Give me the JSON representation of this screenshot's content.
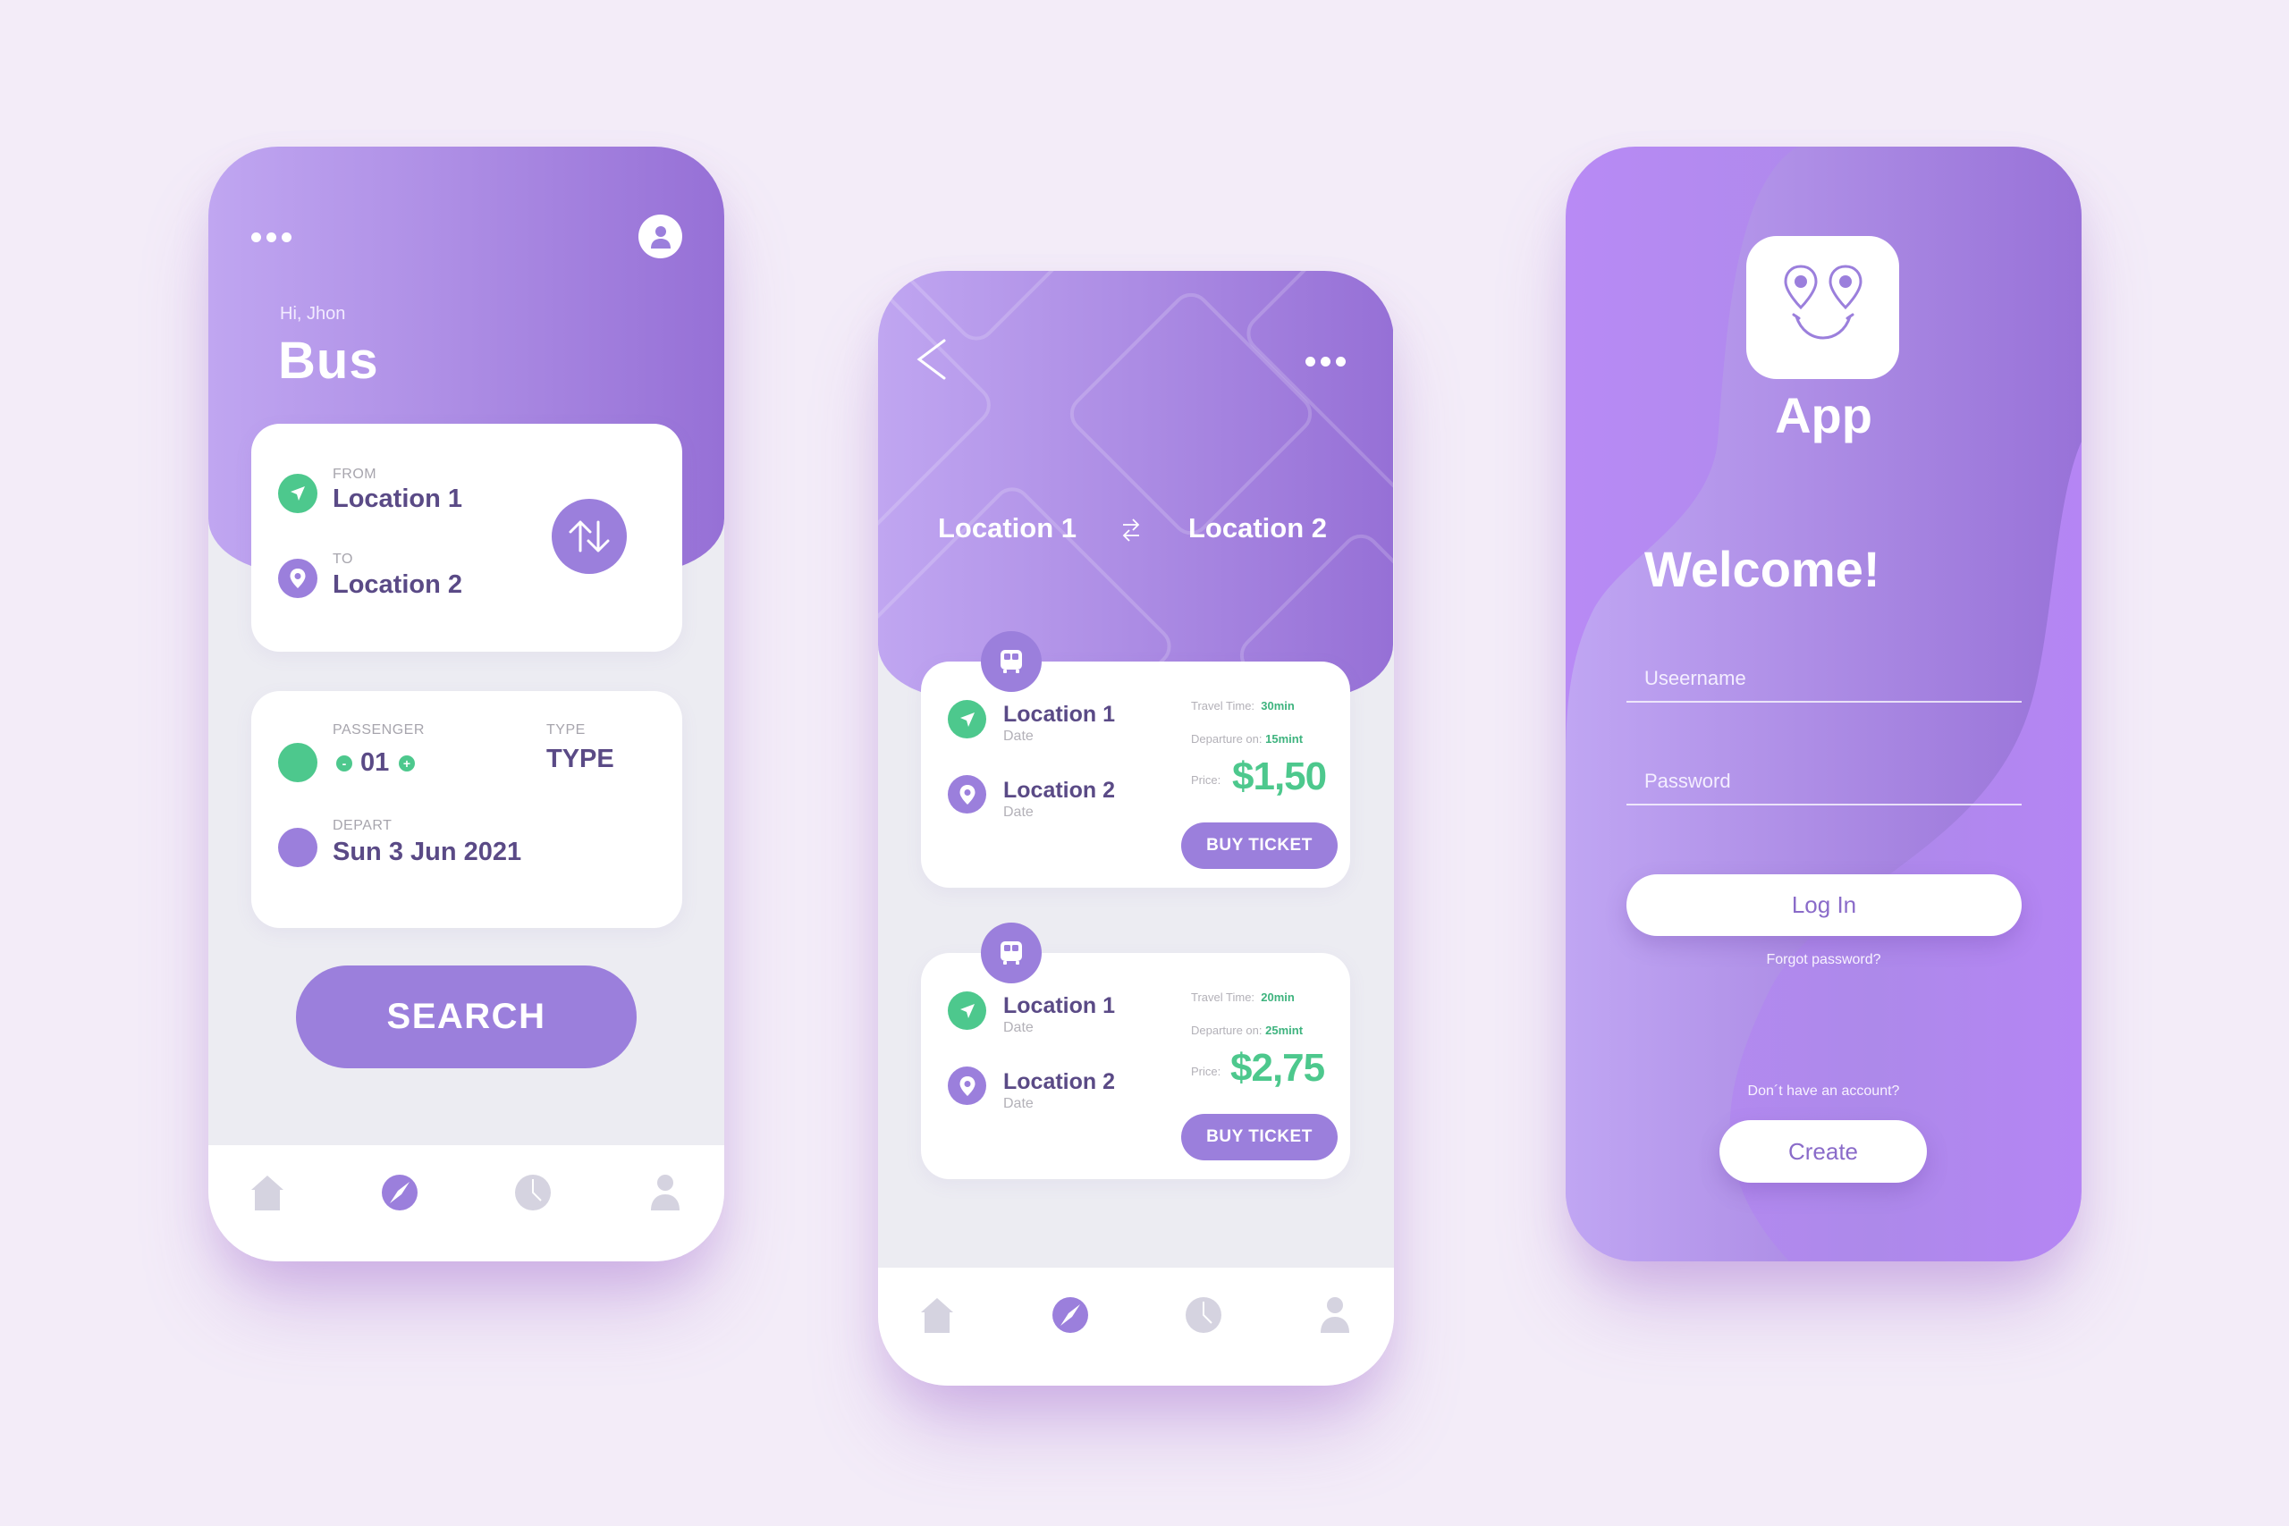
{
  "colors": {
    "background": "#f3ecf8",
    "accent_purple": "#9b7fdc",
    "accent_green": "#4dc88d",
    "text_dark": "#5a4a86",
    "text_muted": "#a7a5ad",
    "icon_inactive": "#d5d3e0"
  },
  "search_screen": {
    "menu_icon": "more-horizontal-icon",
    "profile_icon": "user-icon",
    "greeting": "Hi, Jhon",
    "title": "Bus",
    "route_card": {
      "from_label": "FROM",
      "from_value": "Location 1",
      "to_label": "TO",
      "to_value": "Location 2",
      "swap_icon": "swap-vertical-icon"
    },
    "details_card": {
      "passenger_label": "PASSENGER",
      "passenger_count": "01",
      "minus_label": "-",
      "plus_label": "+",
      "type_label": "TYPE",
      "type_value": "TYPE",
      "depart_label": "DEPART",
      "depart_value": "Sun 3 Jun 2021"
    },
    "search_button": "SEARCH",
    "nav": {
      "items": [
        {
          "icon": "home-icon",
          "active": false
        },
        {
          "icon": "compass-icon",
          "active": true
        },
        {
          "icon": "clock-icon",
          "active": false
        },
        {
          "icon": "user-icon",
          "active": false
        }
      ]
    }
  },
  "results_screen": {
    "back_icon": "chevron-left-icon",
    "menu_icon": "more-horizontal-icon",
    "from": "Location 1",
    "to": "Location 2",
    "swap_icon": "swap-horizontal-icon",
    "tickets": [
      {
        "from": "Location 1",
        "from_date": "Date",
        "to": "Location 2",
        "to_date": "Date",
        "travel_time_label": "Travel Time:",
        "travel_time": "30min",
        "departure_label": "Departure on:",
        "departure": "15mint",
        "price_label": "Price:",
        "price": "$1,50",
        "button": "BUY TICKET"
      },
      {
        "from": "Location 1",
        "from_date": "Date",
        "to": "Location 2",
        "to_date": "Date",
        "travel_time_label": "Travel Time:",
        "travel_time": "20min",
        "departure_label": "Departure on:",
        "departure": "25mint",
        "price_label": "Price:",
        "price": "$2,75",
        "button": "BUY TICKET"
      }
    ],
    "nav": {
      "items": [
        {
          "icon": "home-icon",
          "active": false
        },
        {
          "icon": "compass-icon",
          "active": true
        },
        {
          "icon": "clock-icon",
          "active": false
        },
        {
          "icon": "user-icon",
          "active": false
        }
      ]
    }
  },
  "login_screen": {
    "logo_icon": "smiling-map-pins-icon",
    "app_name": "App",
    "welcome": "Welcome!",
    "username_placeholder": "Useername",
    "password_placeholder": "Password",
    "login_button": "Log In",
    "forgot_password": "Forgot password?",
    "no_account": "Don´t have an account?",
    "create_button": "Create"
  }
}
